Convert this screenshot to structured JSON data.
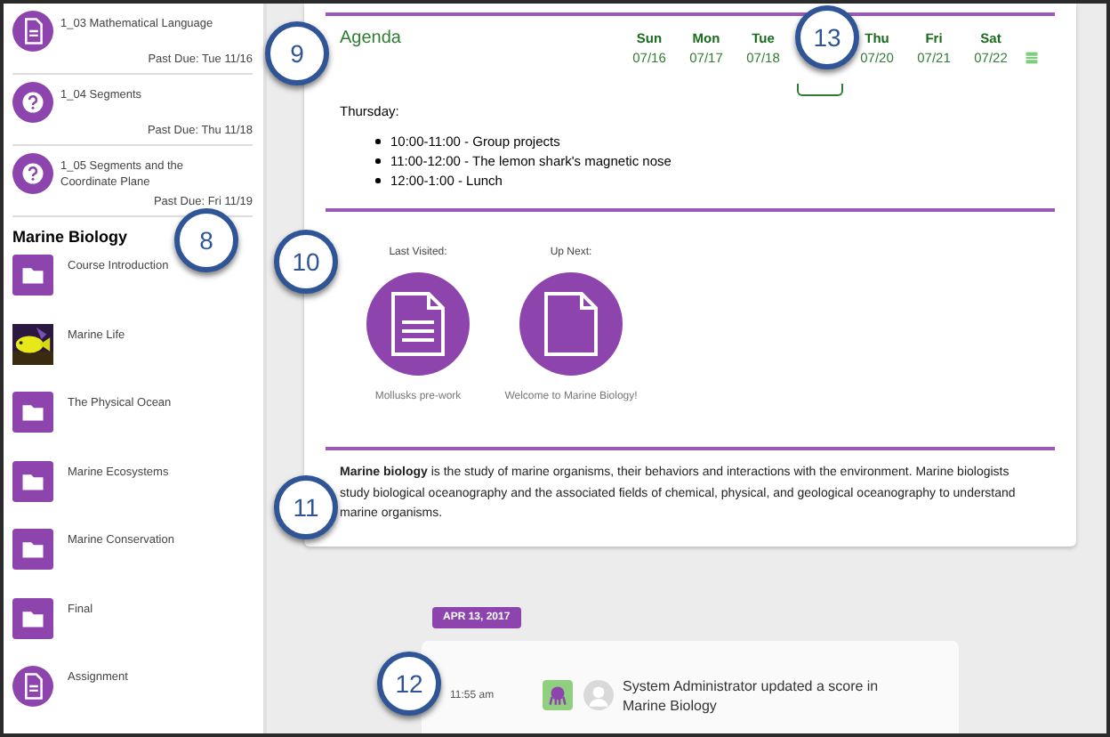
{
  "sidebar": {
    "due_items": [
      {
        "kind": "document",
        "title": "1_03 Mathematical Language",
        "due": "Past Due: Tue 11/16"
      },
      {
        "kind": "question",
        "title": "1_04 Segments",
        "due": "Past Due: Thu 11/18"
      },
      {
        "kind": "question",
        "title": "1_05 Segments and the Coordinate Plane",
        "due": "Past Due: Fri 11/19"
      }
    ],
    "course_title": "Marine Biology",
    "course_items": [
      {
        "kind": "folder",
        "title": "Course Introduction"
      },
      {
        "kind": "picture",
        "title": "Marine Life"
      },
      {
        "kind": "folder",
        "title": "The Physical Ocean"
      },
      {
        "kind": "folder",
        "title": "Marine Ecosystems"
      },
      {
        "kind": "folder",
        "title": "Marine Conservation"
      },
      {
        "kind": "folder",
        "title": "Final"
      },
      {
        "kind": "assignment",
        "title": "Assignment"
      }
    ]
  },
  "agenda": {
    "title": "Agenda",
    "days": [
      {
        "day": "Sun",
        "date": "07/16",
        "selected": false
      },
      {
        "day": "Mon",
        "date": "07/17",
        "selected": false
      },
      {
        "day": "Tue",
        "date": "07/18",
        "selected": false
      },
      {
        "selected": true
      },
      {
        "day": "Thu",
        "date": "07/20",
        "selected": false
      },
      {
        "day": "Fri",
        "date": "07/21",
        "selected": false
      },
      {
        "day": "Sat",
        "date": "07/22",
        "selected": false
      }
    ],
    "heading": "Thursday:",
    "entries": [
      "10:00-11:00 - Group projects",
      "11:00-12:00 - The lemon shark's magnetic nose",
      "12:00-1:00 - Lunch"
    ]
  },
  "visits": [
    {
      "label": "Last Visited:",
      "kind": "document",
      "title": "Mollusks pre-work"
    },
    {
      "label": "Up Next:",
      "kind": "blank",
      "title": "Welcome to Marine Biology!"
    }
  ],
  "description": "**Marine biology** is the study of marine organisms, their behaviors and interactions with the environment. Marine biologists study biological oceanography and the associated fields of chemical, physical, and geological oceanography to understand marine organisms.",
  "activity": {
    "date": "APR 13, 2017",
    "time": "11:55 am",
    "message": "System Administrator updated a score in Marine Biology"
  },
  "callouts": [
    "8",
    "9",
    "10",
    "11",
    "12",
    "13"
  ]
}
